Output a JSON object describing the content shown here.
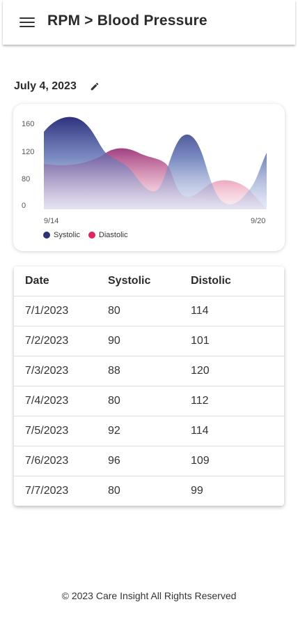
{
  "header": {
    "title": "RPM > Blood Pressure",
    "menu_icon": "menu-icon"
  },
  "date": {
    "label": "July 4, 2023",
    "edit_icon": "pencil-icon"
  },
  "chart_data": {
    "type": "area",
    "x_tick_labels": [
      "9/14",
      "9/20"
    ],
    "y_tick_labels": [
      "0",
      "80",
      "120",
      "160"
    ],
    "series": [
      {
        "name": "Systolic",
        "color": "#2e3078"
      },
      {
        "name": "Diastolic",
        "color": "#e0245e"
      }
    ],
    "legend_position": "bottom-left",
    "grid": false
  },
  "table": {
    "headers": [
      "Date",
      "Systolic",
      "Distolic"
    ],
    "rows": [
      [
        "7/1/2023",
        "80",
        "114"
      ],
      [
        "7/2/2023",
        "90",
        "101"
      ],
      [
        "7/3/2023",
        "88",
        "120"
      ],
      [
        "7/4/2023",
        "80",
        "112"
      ],
      [
        "7/5/2023",
        "92",
        "114"
      ],
      [
        "7/6/2023",
        "96",
        "109"
      ],
      [
        "7/7/2023",
        "80",
        "99"
      ]
    ]
  },
  "footer": {
    "text": "© 2023 Care Insight All Rights Reserved"
  }
}
